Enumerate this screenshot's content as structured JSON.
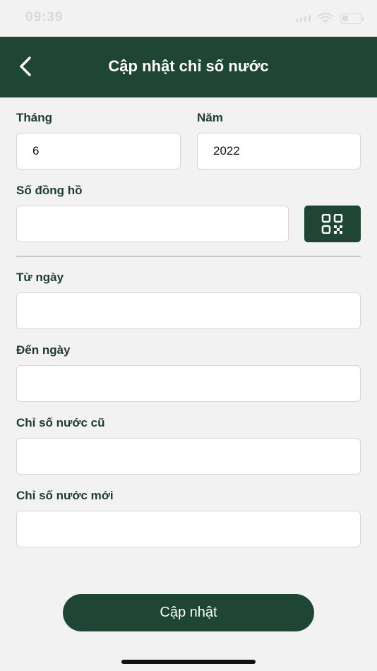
{
  "status_bar": {
    "time": "09:39"
  },
  "header": {
    "title": "Cập nhật chỉ số nước"
  },
  "form": {
    "month": {
      "label": "Tháng",
      "value": "6"
    },
    "year": {
      "label": "Năm",
      "value": "2022"
    },
    "meter": {
      "label": "Số đồng hồ",
      "value": ""
    },
    "from_date": {
      "label": "Từ ngày",
      "value": ""
    },
    "to_date": {
      "label": "Đến ngày",
      "value": ""
    },
    "old_reading": {
      "label": "Chỉ số nước cũ",
      "value": ""
    },
    "new_reading": {
      "label": "Chỉ số nước mới",
      "value": ""
    }
  },
  "actions": {
    "submit_label": "Cập nhật"
  },
  "icons": {
    "back": "chevron-left-icon",
    "scan": "qr-code-icon",
    "wifi": "wifi-icon",
    "battery": "battery-icon"
  },
  "colors": {
    "primary": "#1f4535",
    "background": "#f2f2f2",
    "label": "#1f3a30"
  }
}
